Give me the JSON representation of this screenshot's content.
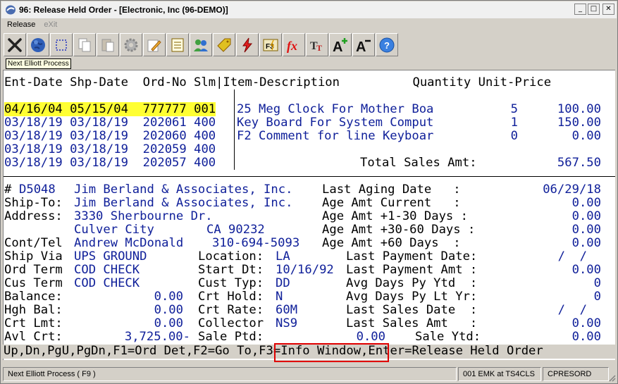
{
  "window": {
    "title": "96: Release Held Order - [Electronic, Inc (96-DEMO)]",
    "controls": {
      "minimize": "_",
      "maximize": "□",
      "close": "✕"
    }
  },
  "menu": [
    {
      "label": "Release",
      "enabled": true
    },
    {
      "label": "eXit",
      "enabled": false
    }
  ],
  "toolbar": {
    "buttons": [
      {
        "name": "next-process-button",
        "icon": "tools-cross-icon"
      },
      {
        "name": "globe-button",
        "icon": "globe-icon"
      },
      {
        "name": "select-button",
        "icon": "dashed-rect-icon"
      },
      {
        "name": "copy-button",
        "icon": "copy-icon"
      },
      {
        "name": "paste-button",
        "icon": "paste-icon"
      },
      {
        "name": "settings-button",
        "icon": "gear-icon"
      },
      {
        "name": "edit-button",
        "icon": "edit-pencil-icon"
      },
      {
        "name": "notes-button",
        "icon": "notepad-icon"
      },
      {
        "name": "users-button",
        "icon": "users-icon"
      },
      {
        "name": "tag-button",
        "icon": "tag-icon"
      },
      {
        "name": "lightning-button",
        "icon": "lightning-icon"
      },
      {
        "name": "f3-button",
        "icon": "f3-icon"
      },
      {
        "name": "function-button",
        "icon": "fx-icon"
      },
      {
        "name": "font-button",
        "icon": "font-tt-icon"
      },
      {
        "name": "font-larger-button",
        "icon": "font-larger-icon"
      },
      {
        "name": "font-smaller-button",
        "icon": "font-smaller-icon"
      },
      {
        "name": "help-button",
        "icon": "help-icon"
      }
    ],
    "tooltip": "Next Elliott Process"
  },
  "order_table": {
    "header": "Ent-Date Shp-Date  Ord-No Slm|Item-Description          Quantity Unit-Price",
    "rows": [
      {
        "ent_date": "04/16/04",
        "shp_date": "05/15/04",
        "ord_no": "777777",
        "slm": "001",
        "item": "25 Meg Clock For Mother Boa",
        "qty": "5",
        "price": "100.00",
        "selected": true
      },
      {
        "ent_date": "03/18/19",
        "shp_date": "03/18/19",
        "ord_no": "202061",
        "slm": "400",
        "item": "Key Board For System Comput",
        "qty": "1",
        "price": "150.00",
        "selected": false
      },
      {
        "ent_date": "03/18/19",
        "shp_date": "03/18/19",
        "ord_no": "202060",
        "slm": "400",
        "item": "F2 Comment for line Keyboar",
        "qty": "0",
        "price": "0.00",
        "selected": false
      },
      {
        "ent_date": "03/18/19",
        "shp_date": "03/18/19",
        "ord_no": "202059",
        "slm": "400",
        "item": "",
        "qty": "",
        "price": "",
        "selected": false
      },
      {
        "ent_date": "03/18/19",
        "shp_date": "03/18/19",
        "ord_no": "202057",
        "slm": "400",
        "item": "",
        "qty": "",
        "price": "",
        "selected": false
      }
    ],
    "total_label": "Total Sales Amt:",
    "total_value": "567.50"
  },
  "customer": {
    "number_label": "#",
    "number": "D5048",
    "name": "Jim Berland & Associates, Inc.",
    "ship_to_label": "Ship-To:",
    "ship_to": "Jim Berland & Associates, Inc.",
    "address_label": "Address:",
    "address1": "3330 Sherbourne Dr.",
    "city": "Culver City",
    "state_zip": "CA 90232",
    "cont_tel_label": "Cont/Tel",
    "contact": "Andrew McDonald",
    "phone": "310-694-5093",
    "ship_via_label": "Ship Via",
    "ship_via": "UPS GROUND",
    "ord_term_label": "Ord Term",
    "ord_term": "COD CHECK",
    "cus_term_label": "Cus Term",
    "cus_term": "COD CHECK",
    "balance_label": "Balance:",
    "balance": "0.00",
    "hgh_bal_label": "Hgh Bal:",
    "hgh_bal": "0.00",
    "crt_lmt_label": "Crt Lmt:",
    "crt_lmt": "0.00",
    "avl_crt_label": "Avl Crt:",
    "avl_crt": "3,725.00-",
    "location_label": "Location:",
    "location": "LA",
    "start_dt_label": "Start Dt:",
    "start_dt": "10/16/92",
    "cust_typ_label": "Cust Typ:",
    "cust_typ": "DD",
    "crt_hold_label": "Crt Hold:",
    "crt_hold": "N",
    "crt_rate_label": "Crt Rate:",
    "crt_rate": "60M",
    "collector_label": "Collector",
    "collector": "NS9",
    "sale_ptd_label": "Sale Ptd:",
    "sale_ptd": "0.00"
  },
  "aging": [
    {
      "label": "Last Aging Date   :",
      "value": "06/29/18"
    },
    {
      "label": "Age Amt Current   :",
      "value": "0.00"
    },
    {
      "label": "Age Amt +1-30 Days :",
      "value": "0.00"
    },
    {
      "label": "Age Amt +30-60 Days :",
      "value": "0.00"
    },
    {
      "label": "Age Amt +60 Days  :",
      "value": "0.00"
    }
  ],
  "payment": [
    {
      "label": "Last Payment Date:",
      "value": "/  /"
    },
    {
      "label": "Last Payment Amt :",
      "value": "0.00"
    },
    {
      "label": "Avg Days Py Ytd  :",
      "value": "0"
    },
    {
      "label": "Avg Days Py Lt Yr:",
      "value": "0"
    },
    {
      "label": "Last Sales Date  :",
      "value": "/  /"
    },
    {
      "label": "Last Sales Amt   :",
      "value": "0.00"
    },
    {
      "label": "Sale Ytd:",
      "value": "0.00"
    }
  ],
  "function_keys": {
    "before": "Up,Dn,PgU,PgDn,F1=Ord Det,F2=Go To,",
    "highlighted": "F3=Info Window",
    "after": ",Enter=Release Held Order",
    "highlight_color": "#e00000"
  },
  "status_bar": {
    "hint": "Next Elliott Process ( F9 )",
    "session": "001 EMK at TS4CLS",
    "program": "CPRESORD"
  },
  "colors": {
    "highlight_row": "#ffff33",
    "data_text": "#10209a",
    "label_text": "#000000"
  }
}
